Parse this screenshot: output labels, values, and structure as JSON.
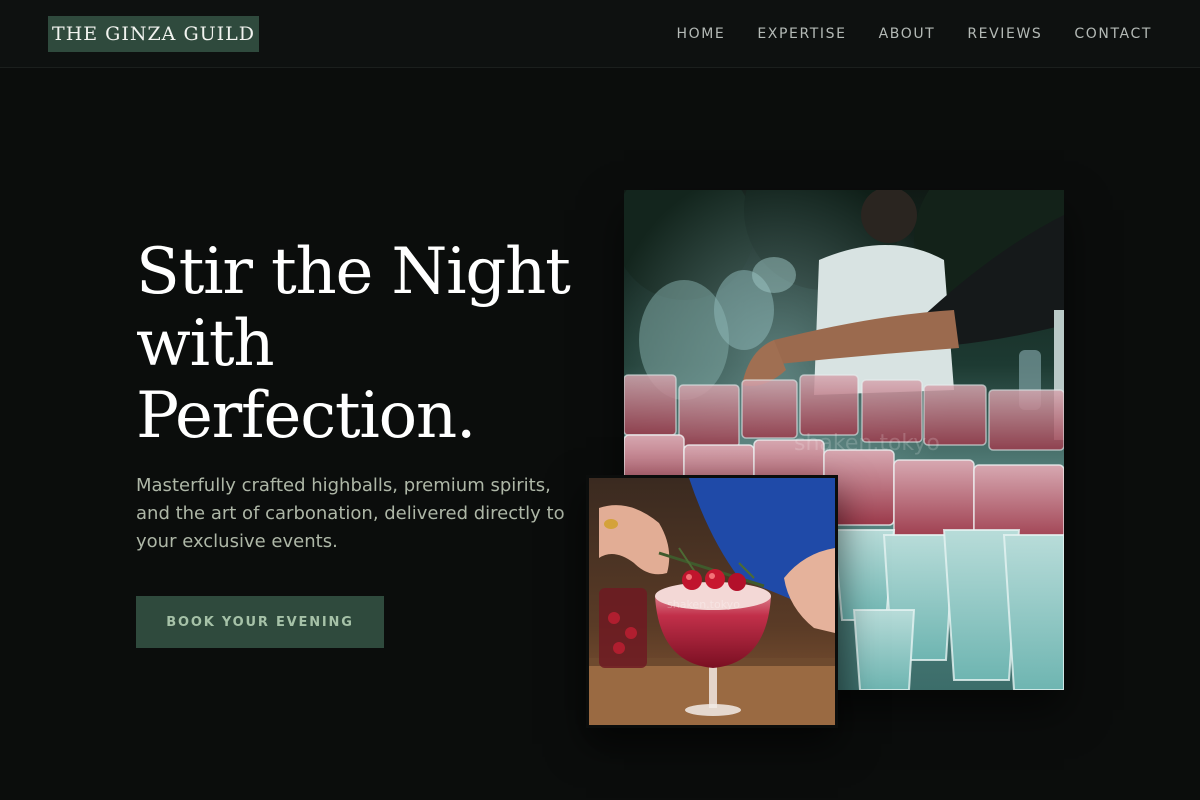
{
  "header": {
    "logo": "THE GINZA GUILD",
    "nav": [
      "HOME",
      "EXPERTISE",
      "ABOUT",
      "REVIEWS",
      "CONTACT"
    ]
  },
  "hero": {
    "headline_lines": [
      "Stir the Night",
      "with",
      "Perfection."
    ],
    "subtext": "Masterfully crafted highballs, premium spirits, and the art of carbonation, delivered directly to your exclusive events.",
    "cta_label": "BOOK YOUR EVENING"
  },
  "images": {
    "large_alt": "Bartender pouring into rows of glasses at an outdoor event",
    "small_alt": "Hands holding a red cocktail garnished with cranberries and rosemary",
    "watermark": "shaken.tokyo"
  },
  "colors": {
    "background": "#0b0d0c",
    "accent_green": "#2f4a3d",
    "cta_text": "#a6c2a8",
    "subtext": "#aeb7a7"
  }
}
